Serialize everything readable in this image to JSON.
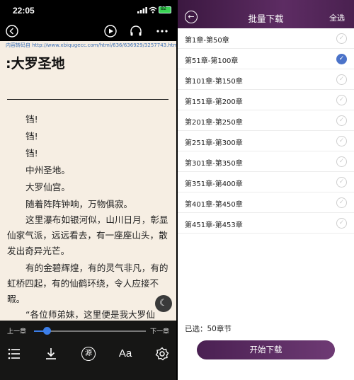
{
  "reader": {
    "status_time": "22:05",
    "battery": "82",
    "url_tag": "内容转码自",
    "url": "http://www.xbiqugecc.com/html/636/636929/3257743.html",
    "chapter_title": ":大罗圣地",
    "paragraphs": [
      "铛!",
      "铛!",
      "铛!",
      "中州圣地。",
      "大罗仙宫。",
      "随着阵阵钟响，万物俱寂。",
      "这里瀑布如银河似，山川日月，彰显仙家气派，远远看去，有一座座山头，散发出奇异光芒。",
      "有的金碧辉煌，有的灵气非凡，有的虹桥四起，有的仙鹤环绕，令人应接不暇。",
      "“各位师弟妹，这里便是我大罗仙"
    ],
    "prev_chapter": "上一章",
    "next_chapter": "下一章",
    "progress_fraction": 0.12,
    "source_label": "源",
    "font_label": "Aa"
  },
  "batch": {
    "title": "批量下载",
    "select_all": "全选",
    "chapters": [
      {
        "label": "第1章-第50章",
        "checked": false
      },
      {
        "label": "第51章-第100章",
        "checked": true
      },
      {
        "label": "第101章-第150章",
        "checked": false
      },
      {
        "label": "第151章-第200章",
        "checked": false
      },
      {
        "label": "第201章-第250章",
        "checked": false
      },
      {
        "label": "第251章-第300章",
        "checked": false
      },
      {
        "label": "第301章-第350章",
        "checked": false
      },
      {
        "label": "第351章-第400章",
        "checked": false
      },
      {
        "label": "第401章-第450章",
        "checked": false
      },
      {
        "label": "第451章-第453章",
        "checked": false
      }
    ],
    "selected_text": "已选：50章节",
    "start_button": "开始下载"
  },
  "colors": {
    "accent": "#4b73c9",
    "header_purple": "#5d2c63",
    "reader_bg": "#f6eee3",
    "slider_blue": "#3c7ee8"
  }
}
